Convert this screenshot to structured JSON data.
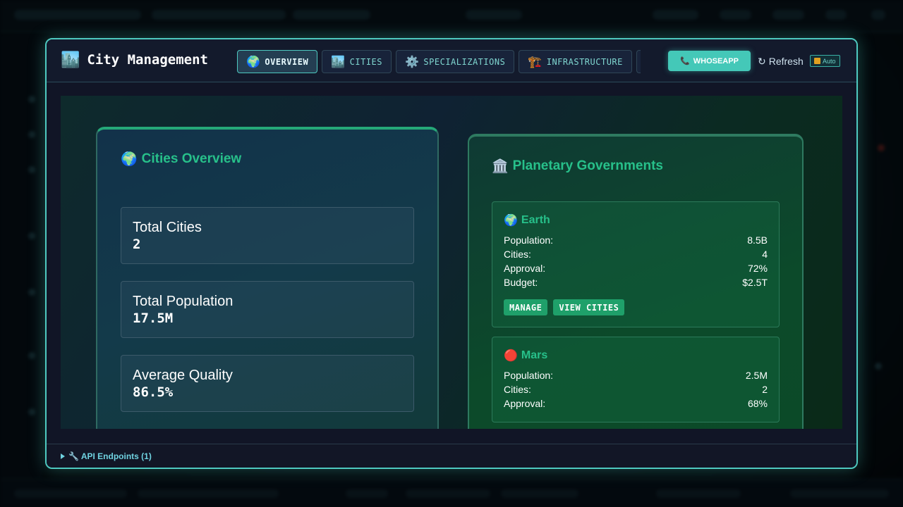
{
  "modal": {
    "title": "City Management",
    "title_icon": "🏙️",
    "tabs": [
      {
        "icon": "🌍",
        "label": "OVERVIEW",
        "active": true
      },
      {
        "icon": "🏙️",
        "label": "CITIES",
        "active": false
      },
      {
        "icon": "⚙️",
        "label": "SPECIALIZATIONS",
        "active": false
      },
      {
        "icon": "🏗️",
        "label": "INFRASTRUCTURE",
        "active": false
      }
    ],
    "whoseapp_label": "WHOSEAPP",
    "whoseapp_icon": "📞",
    "refresh_label": "Refresh",
    "refresh_icon": "↻",
    "auto_label": "Auto"
  },
  "cities_overview": {
    "title": "Cities Overview",
    "icon": "🌍",
    "stats": [
      {
        "label": "Total Cities",
        "value": "2"
      },
      {
        "label": "Total Population",
        "value": "17.5M"
      },
      {
        "label": "Average Quality",
        "value": "86.5%"
      }
    ]
  },
  "planetary_governments": {
    "title": "Planetary Governments",
    "icon": "🏛️",
    "planets": [
      {
        "icon": "🌍",
        "name": "Earth",
        "rows": [
          {
            "label": "Population:",
            "value": "8.5B"
          },
          {
            "label": "Cities:",
            "value": "4"
          },
          {
            "label": "Approval:",
            "value": "72%"
          },
          {
            "label": "Budget:",
            "value": "$2.5T"
          }
        ],
        "actions": [
          "MANAGE",
          "VIEW CITIES"
        ]
      },
      {
        "icon": "🔴",
        "name": "Mars",
        "rows": [
          {
            "label": "Population:",
            "value": "2.5M"
          },
          {
            "label": "Cities:",
            "value": "2"
          },
          {
            "label": "Approval:",
            "value": "68%"
          }
        ]
      }
    ]
  },
  "footer": {
    "api_label": "🔧 API Endpoints (1)"
  },
  "colors": {
    "accent": "#4ec9c0",
    "green": "#27c08a",
    "button_green": "#1fa06a"
  }
}
